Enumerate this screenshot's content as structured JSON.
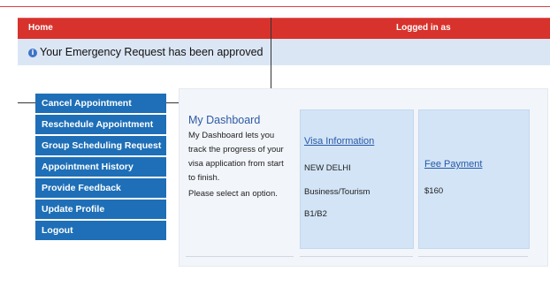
{
  "nav": {
    "home": "Home",
    "logged_in": "Logged in as"
  },
  "notice": {
    "icon": "info-icon",
    "message": "Your Emergency Request has been approved"
  },
  "menu": {
    "items": [
      {
        "label": "Cancel Appointment"
      },
      {
        "label": "Reschedule Appointment"
      },
      {
        "label": "Group Scheduling Request"
      },
      {
        "label": "Appointment History"
      },
      {
        "label": "Provide Feedback"
      },
      {
        "label": "Update Profile"
      },
      {
        "label": "Logout"
      }
    ]
  },
  "dashboard": {
    "title": "My Dashboard",
    "description": "My Dashboard lets you track the progress of your visa application from start to finish.",
    "prompt": "Please select an option."
  },
  "visa": {
    "title": "Visa Information",
    "city": "NEW DELHI",
    "category": "Business/Tourism",
    "type": "B1/B2"
  },
  "fee": {
    "title": "Fee Payment",
    "amount": "$160"
  },
  "colors": {
    "nav_bg": "#d8322c",
    "notice_bg": "#dbe6f5",
    "menu_bg": "#1e6fb7",
    "card_bg": "#d2e4f6",
    "link": "#2858a8"
  }
}
